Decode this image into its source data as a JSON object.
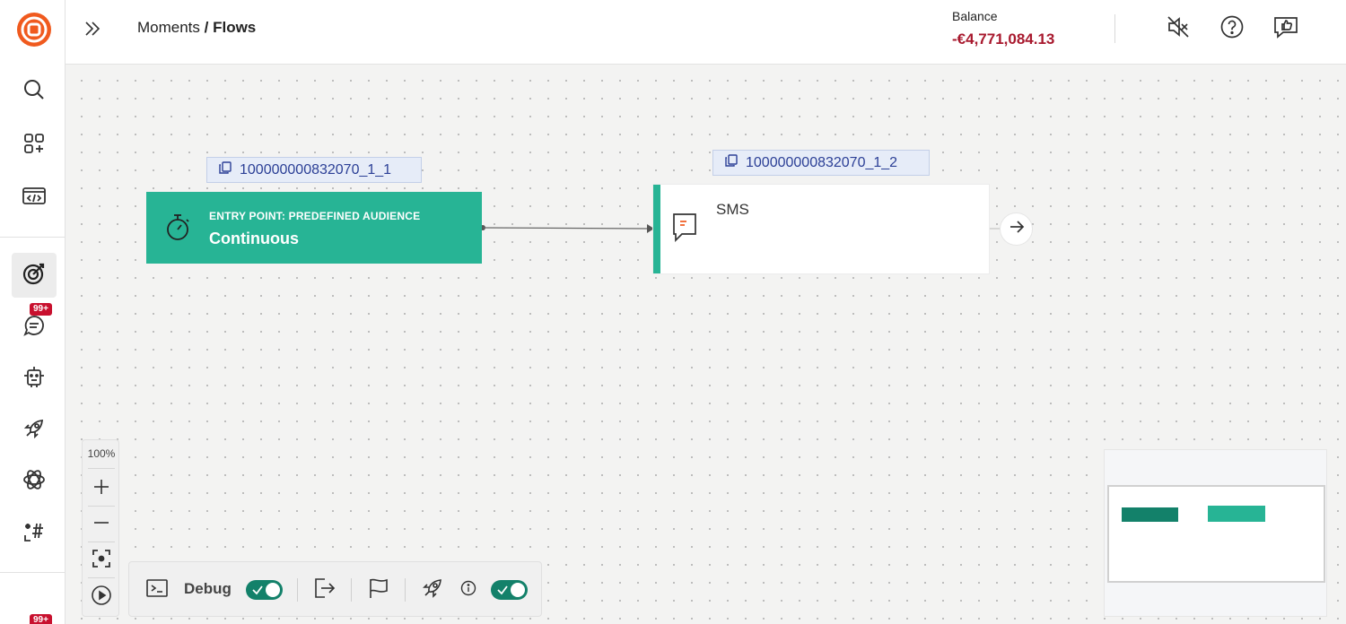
{
  "header": {
    "breadcrumb_parent": "Moments",
    "breadcrumb_separator": " / ",
    "breadcrumb_current": "Flows",
    "balance_label": "Balance",
    "balance_value": "-€4,771,084.13"
  },
  "sidebar": {
    "badge_messages": "99+",
    "badge_bottom": "99+",
    "items": [
      {
        "icon": "search-icon"
      },
      {
        "icon": "apps-icon"
      },
      {
        "icon": "code-icon"
      },
      {
        "icon": "target-icon"
      },
      {
        "icon": "chat-icon"
      },
      {
        "icon": "bot-icon"
      },
      {
        "icon": "rocket-icon"
      },
      {
        "icon": "ai-icon"
      },
      {
        "icon": "hashtag-icon"
      }
    ]
  },
  "flow": {
    "entry": {
      "tag": "100000000832070_1_1",
      "title": "ENTRY POINT: PREDEFINED AUDIENCE",
      "subtitle": "Continuous",
      "color": "#27b495"
    },
    "sms": {
      "tag": "100000000832070_1_2",
      "title": "SMS",
      "accent": "#27b495"
    }
  },
  "zoom": {
    "level": "100%"
  },
  "toolbar": {
    "debug_label": "Debug",
    "debug_enabled": true,
    "active_enabled": true
  },
  "colors": {
    "brand_orange": "#f05a1e",
    "balance_red": "#a8192e",
    "teal": "#27b495",
    "teal_dark": "#13816a"
  }
}
